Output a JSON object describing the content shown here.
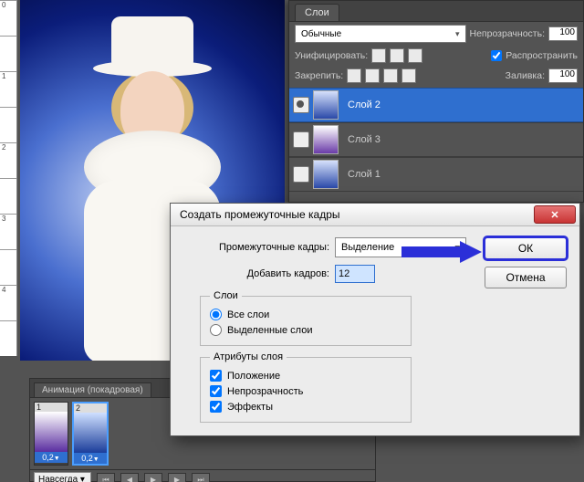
{
  "ruler": {
    "ticks": [
      "0",
      "",
      "1",
      "",
      "2",
      "",
      "3",
      "",
      "4",
      "",
      ""
    ]
  },
  "layers_panel": {
    "tab": "Слои",
    "blend_mode": "Обычные",
    "opacity_label": "Непрозрачность:",
    "opacity_value": "100",
    "unify_label": "Унифицировать:",
    "propagate_label": "Распространить",
    "propagate_checked": true,
    "lock_label": "Закрепить:",
    "fill_label": "Заливка:",
    "fill_value": "100",
    "layers": [
      {
        "name": "Слой 2",
        "visible": true,
        "selected": true,
        "thumb": "blue"
      },
      {
        "name": "Слой 3",
        "visible": false,
        "selected": false,
        "thumb": "purple"
      },
      {
        "name": "Слой 1",
        "visible": false,
        "selected": false,
        "thumb": "blue"
      }
    ]
  },
  "animation_panel": {
    "tab": "Анимация (покадровая)",
    "frames": [
      {
        "index": "1",
        "delay": "0,2",
        "thumb": "purple",
        "selected": false
      },
      {
        "index": "2",
        "delay": "0,2",
        "thumb": "blue",
        "selected": true
      }
    ],
    "loop": "Навсегда"
  },
  "dialog": {
    "title": "Создать промежуточные кадры",
    "tween_with_label": "Промежуточные кадры:",
    "tween_with_value": "Выделение",
    "frames_to_add_label": "Добавить кадров:",
    "frames_to_add_value": "12",
    "layers_group": {
      "legend": "Слои",
      "all": "Все слои",
      "selected": "Выделенные слои",
      "value": "all"
    },
    "params_group": {
      "legend": "Атрибуты слоя",
      "position": "Положение",
      "opacity": "Непрозрачность",
      "effects": "Эффекты",
      "position_checked": true,
      "opacity_checked": true,
      "effects_checked": true
    },
    "ok": "ОК",
    "cancel": "Отмена"
  }
}
